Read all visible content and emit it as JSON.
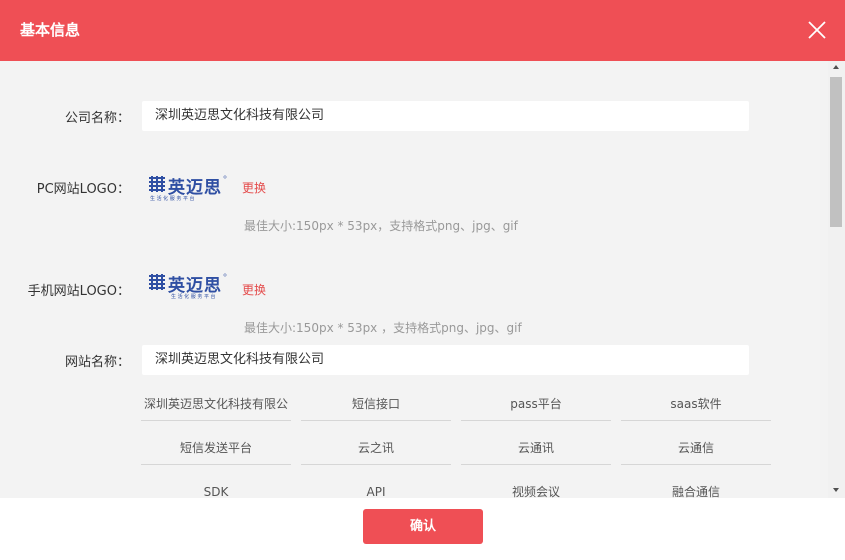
{
  "header": {
    "title": "基本信息",
    "close_icon": "close-icon"
  },
  "form": {
    "company_name_label": "公司名称：",
    "company_name_value": "深圳英迈思文化科技有限公司",
    "pc_logo_label": "PC网站LOGO：",
    "pc_logo_text": "英迈思",
    "pc_logo_sub": "生 活 化 服 务 平 台",
    "pc_change": "更换",
    "pc_hint": "最佳大小:150px * 53px，支持格式png、jpg、gif",
    "mobile_logo_label": "手机网站LOGO：",
    "mobile_logo_text": "英迈思",
    "mobile_logo_sub": "生 活 化 服 务 平 台",
    "mobile_change": "更换",
    "mobile_hint": "最佳大小:150px * 53px ，支持格式png、jpg、gif",
    "site_name_label": "网站名称：",
    "site_name_value": "深圳英迈思文化科技有限公司"
  },
  "tags": [
    "深圳英迈思文化科技有限公",
    "短信接口",
    "pass平台",
    "saas软件",
    "短信发送平台",
    "云之讯",
    "云通讯",
    "云通信",
    "SDK",
    "API",
    "视频会议",
    "融合通信"
  ],
  "footer": {
    "confirm_label": "确认"
  },
  "colors": {
    "accent": "#ef4f55",
    "link": "#e44b4b"
  }
}
